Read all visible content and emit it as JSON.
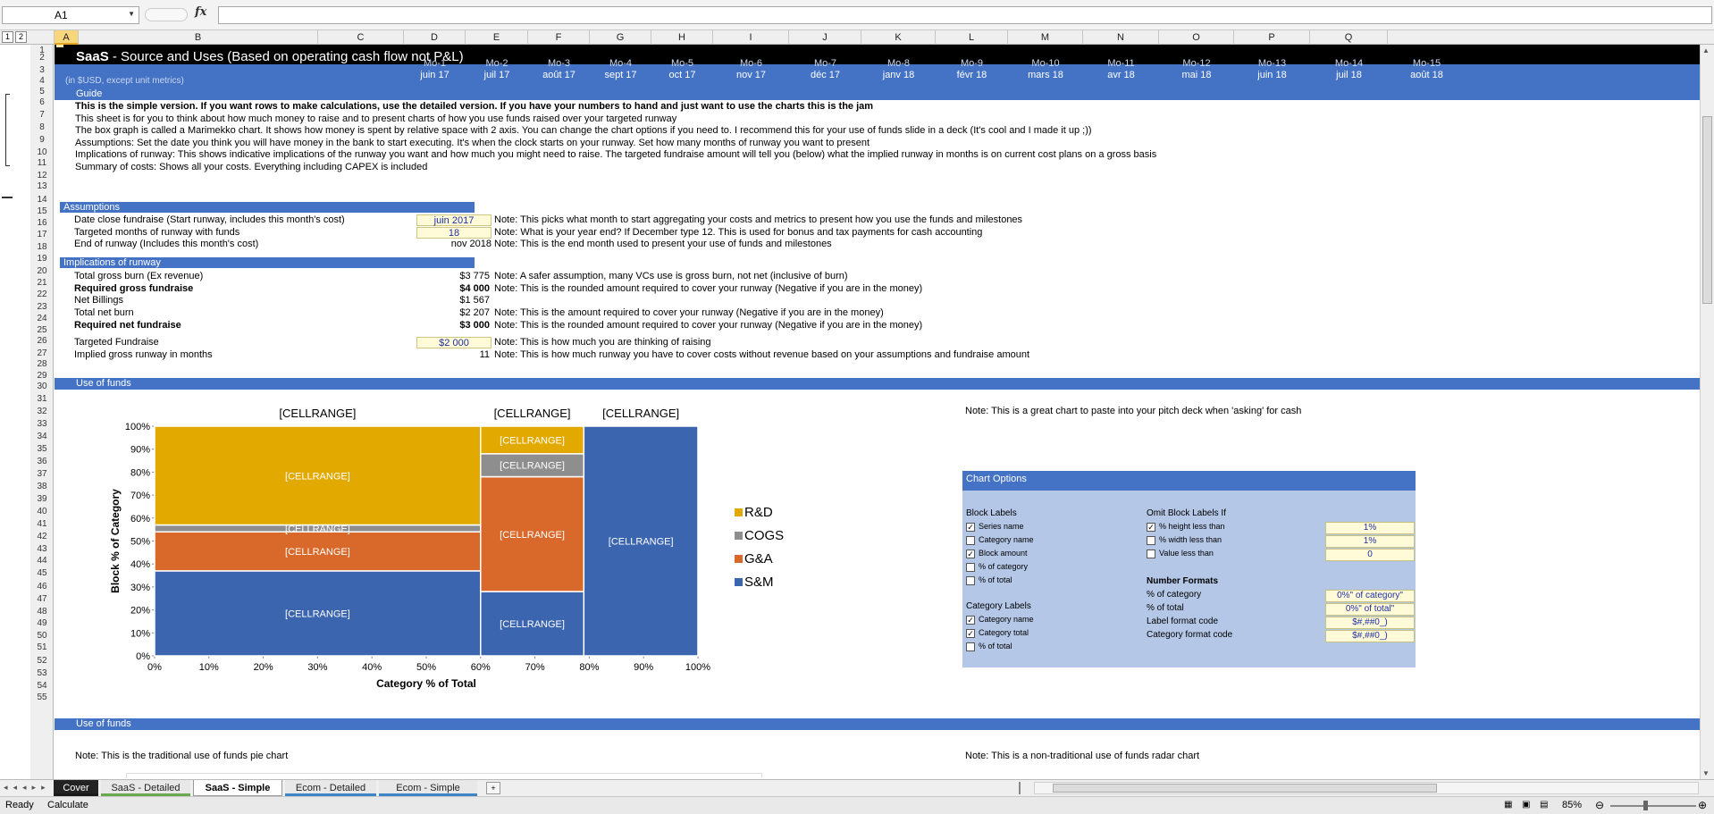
{
  "formula_bar": {
    "name_box": "A1",
    "fx_label": "fx",
    "formula": ""
  },
  "outline_levels": [
    "1",
    "2"
  ],
  "columns": [
    "A",
    "B",
    "C",
    "D",
    "E",
    "F",
    "G",
    "H",
    "I",
    "J",
    "K",
    "L",
    "M",
    "N",
    "O",
    "P",
    "Q"
  ],
  "rows": [
    "1",
    "2",
    "3",
    "4",
    "5",
    "6",
    "7",
    "8",
    "9",
    "10",
    "11",
    "12",
    "13",
    "14",
    "15",
    "16",
    "17",
    "18",
    "19",
    "20",
    "21",
    "22",
    "23",
    "24",
    "25",
    "26",
    "27",
    "28",
    "29",
    "30",
    "31",
    "32",
    "33",
    "34",
    "35",
    "36",
    "37",
    "38",
    "39",
    "40",
    "41",
    "42",
    "43",
    "44",
    "45",
    "46",
    "47",
    "48",
    "49",
    "50",
    "51",
    "52",
    "53",
    "54",
    "55"
  ],
  "title": {
    "bold": "SaaS",
    "rest": " - Source and Uses (Based on operating cash flow not P&L)"
  },
  "units_note": "(in $USD, except unit metrics)",
  "months": [
    "Mo-1",
    "Mo-2",
    "Mo-3",
    "Mo-4",
    "Mo-5",
    "Mo-6",
    "Mo-7",
    "Mo-8",
    "Mo-9",
    "Mo-10",
    "Mo-11",
    "Mo-12",
    "Mo-13",
    "Mo-14",
    "Mo-15"
  ],
  "dates": [
    "juin 17",
    "juil 17",
    "août 17",
    "sept 17",
    "oct 17",
    "nov 17",
    "déc 17",
    "janv 18",
    "févr 18",
    "mars 18",
    "avr 18",
    "mai 18",
    "juin 18",
    "juil 18",
    "août 18"
  ],
  "guide": {
    "header": "Guide",
    "lines": [
      "This is the simple version. If you want rows to make calculations, use the detailed version. If you have your numbers to hand and just want to use the charts this is the jam",
      "This sheet is for you to think about how much money to raise and to present charts of how you use funds raised over your targeted runway",
      "The box graph is called a Marimekko chart. It shows how money is spent by relative space with 2 axis. You can change the chart options if you need to. I recommend this for your use of funds slide in a deck (It's cool and I made it up ;))",
      "Assumptions: Set the date you think you will have money in the bank to start executing. It's when the clock starts on your runway. Set how many months of runway you want to present",
      "Implications of runway: This shows indicative implications of the runway you want and how much you might need to raise. The targeted fundraise amount will tell you (below) what the implied runway in months is on current cost plans on a gross basis",
      "Summary of costs: Shows all your costs. Everything including CAPEX is included"
    ]
  },
  "assumptions": {
    "header": "Assumptions",
    "rows": [
      {
        "label": "Date close fundraise (Start runway, includes this month's cost)",
        "value": "juin 2017",
        "note": "Note: This picks what month to start aggregating your costs and metrics to present how you use the funds and milestones"
      },
      {
        "label": "Targeted months of runway with funds",
        "value": "18",
        "note": "Note: What is your year end? If December type 12. This is used for bonus and tax payments for cash accounting"
      },
      {
        "label": "End of runway (Includes this month's cost)",
        "value": "nov 2018",
        "note": "Note: This is the end month used to present your use of funds and milestones"
      }
    ]
  },
  "implications": {
    "header": "Implications of runway",
    "rows": [
      {
        "label": "Total gross burn (Ex revenue)",
        "value": "$3 775",
        "note": "Note: A safer assumption, many VCs use is gross burn, not net (inclusive of burn)"
      },
      {
        "label": "Required gross fundraise",
        "value": "$4 000",
        "note": "Note: This is the rounded amount required to cover your runway (Negative if you are in the money)"
      },
      {
        "label": "Net Billings",
        "value": "$1 567",
        "note": ""
      },
      {
        "label": "Total net burn",
        "value": "$2 207",
        "note": "Note: This is the amount required to cover your runway (Negative if you are in the money)"
      },
      {
        "label": "Required net fundraise",
        "value": "$3 000",
        "note": "Note: This is the rounded amount required to cover your runway (Negative if you are in the money)"
      },
      {
        "label": "Targeted Fundraise",
        "value": "$2 000",
        "note": "Note: This is how much you are thinking of raising"
      },
      {
        "label": "Implied gross runway in months",
        "value": "11",
        "note": "Note: This is how much runway you have to cover costs without revenue based on your assumptions and fundraise amount"
      }
    ]
  },
  "use_of_funds_header": "Use of funds",
  "deck_note": "Note: This is a great chart to paste into your pitch deck when 'asking' for cash",
  "pie_note": "Note: This is the traditional use of funds pie chart",
  "radar_note": "Note: This is a non-traditional use of funds radar chart",
  "chart_data": {
    "type": "marimekko",
    "xlabel": "Category % of Total",
    "ylabel": "Block % of Category",
    "x_ticks": [
      "0%",
      "10%",
      "20%",
      "30%",
      "40%",
      "50%",
      "60%",
      "70%",
      "80%",
      "90%",
      "100%"
    ],
    "y_ticks": [
      "0%",
      "10%",
      "20%",
      "30%",
      "40%",
      "50%",
      "60%",
      "70%",
      "80%",
      "90%",
      "100%"
    ],
    "column_labels": [
      "[CELLRANGE]",
      "[CELLRANGE]",
      "[CELLRANGE]"
    ],
    "block_label": "[CELLRANGE]",
    "columns": [
      {
        "start": 0,
        "width": 60,
        "blocks": [
          {
            "series": "S&M",
            "value": 37
          },
          {
            "series": "G&A",
            "value": 17
          },
          {
            "series": "COGS",
            "value": 3
          },
          {
            "series": "R&D",
            "value": 43
          }
        ]
      },
      {
        "start": 60,
        "width": 19,
        "blocks": [
          {
            "series": "S&M",
            "value": 28
          },
          {
            "series": "G&A",
            "value": 50
          },
          {
            "series": "COGS",
            "value": 10
          },
          {
            "series": "R&D",
            "value": 12
          }
        ]
      },
      {
        "start": 79,
        "width": 21,
        "blocks": [
          {
            "series": "S&M",
            "value": 100
          }
        ]
      }
    ],
    "legend": [
      {
        "name": "R&D",
        "color": "#e2a900"
      },
      {
        "name": "COGS",
        "color": "#8e8e8e"
      },
      {
        "name": "G&A",
        "color": "#d9692a"
      },
      {
        "name": "S&M",
        "color": "#3b65ae"
      }
    ]
  },
  "chart_options": {
    "header": "Chart Options",
    "block_labels_title": "Block Labels",
    "block_labels": [
      {
        "label": "Series name",
        "checked": true
      },
      {
        "label": "Category name",
        "checked": false
      },
      {
        "label": "Block amount",
        "checked": true
      },
      {
        "label": "% of category",
        "checked": false
      },
      {
        "label": "% of total",
        "checked": false
      }
    ],
    "omit_title": "Omit Block Labels If",
    "omit": [
      {
        "label": "% height less than",
        "checked": true,
        "value": "1%"
      },
      {
        "label": "% width less than",
        "checked": false,
        "value": "1%"
      },
      {
        "label": "Value less than",
        "checked": false,
        "value": "0"
      }
    ],
    "category_labels_title": "Category Labels",
    "category_labels": [
      {
        "label": "Category name",
        "checked": true
      },
      {
        "label": "Category total",
        "checked": true
      },
      {
        "label": "% of total",
        "checked": false
      }
    ],
    "number_formats_title": "Number Formats",
    "number_formats": [
      {
        "label": "% of category",
        "value": "0%\" of category\""
      },
      {
        "label": "% of total",
        "value": "0%\" of total\""
      },
      {
        "label": "Label format code",
        "value": "$#,##0_)"
      },
      {
        "label": "Category format code",
        "value": "$#,##0_)"
      }
    ]
  },
  "sheet_tabs": [
    "Cover",
    "SaaS - Detailed",
    "SaaS - Simple",
    "Ecom - Detailed",
    "Ecom - Simple"
  ],
  "active_tab": "SaaS - Simple",
  "status": {
    "ready": "Ready",
    "calculate": "Calculate",
    "zoom": "85%"
  },
  "colors": {
    "band_blue": "#4472c4",
    "title_black": "#000000",
    "header_bar": "#3a5ea8",
    "input_yellow": "#fffbd8"
  }
}
